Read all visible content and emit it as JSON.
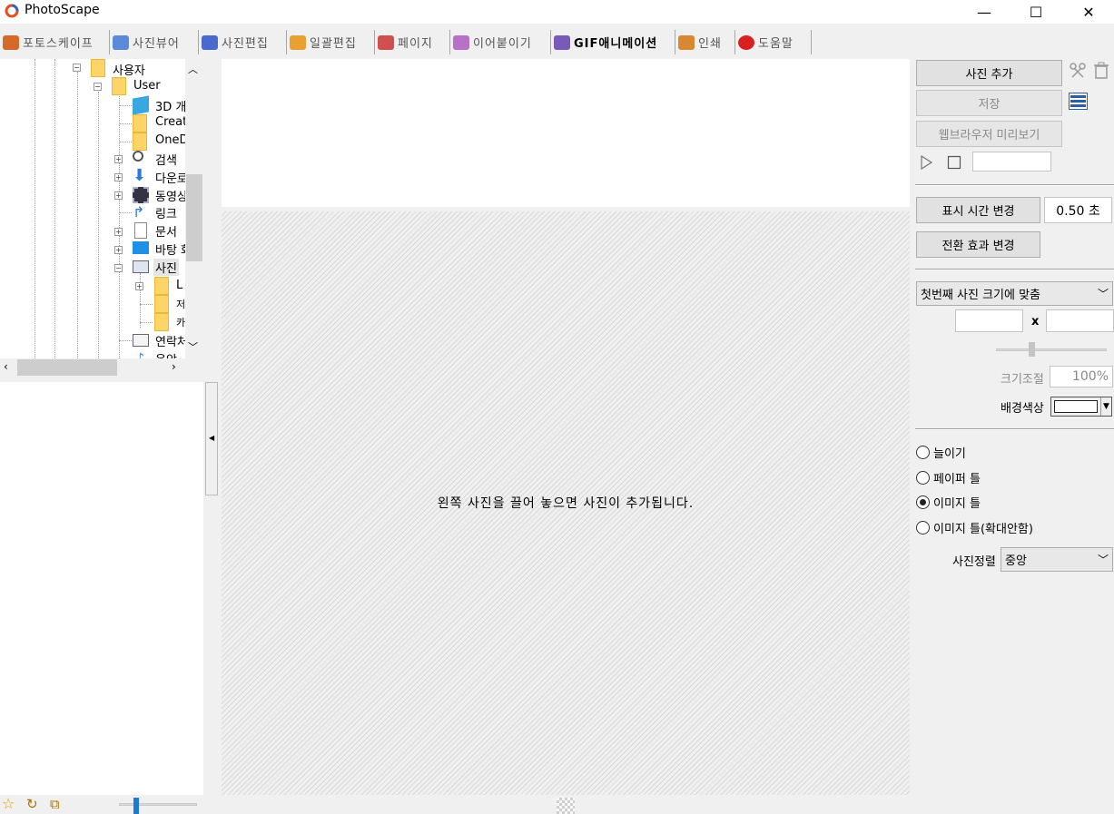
{
  "window": {
    "title": "PhotoScape",
    "minimize": "—",
    "maximize": "☐",
    "close": "✕"
  },
  "tabs": [
    {
      "label": "포토스케이프",
      "color": "#d46a2a",
      "active": false
    },
    {
      "label": "사진뷰어",
      "color": "#5a8ad8",
      "active": false
    },
    {
      "label": "사진편집",
      "color": "#4a6ad0",
      "active": false
    },
    {
      "label": "일괄편집",
      "color": "#e8a030",
      "active": false
    },
    {
      "label": "페이지",
      "color": "#d05050",
      "active": false
    },
    {
      "label": "이어붙이기",
      "color": "#b870c8",
      "active": false
    },
    {
      "label": "GIF애니메이션",
      "color": "#7a5ab8",
      "active": true
    },
    {
      "label": "인쇄",
      "color": "#d88830",
      "active": false
    },
    {
      "label": "도움말",
      "color": "#d82020",
      "active": false
    }
  ],
  "tree": {
    "nodes": [
      {
        "label": "사용자",
        "icon": "folder-icon"
      },
      {
        "label": "User",
        "icon": "folder-icon"
      },
      {
        "label": "3D 개",
        "icon": "cube-icon"
      },
      {
        "label": "Creat",
        "icon": "folder-icon"
      },
      {
        "label": "OneD",
        "icon": "folder-icon"
      },
      {
        "label": "검색",
        "icon": "search-icon"
      },
      {
        "label": "다운로",
        "icon": "download-icon"
      },
      {
        "label": "동영상",
        "icon": "film-icon"
      },
      {
        "label": "링크",
        "icon": "link-icon"
      },
      {
        "label": "문서",
        "icon": "document-icon"
      },
      {
        "label": "바탕 화",
        "icon": "desktop-icon"
      },
      {
        "label": "사진",
        "icon": "pictures-icon"
      },
      {
        "label": "L",
        "icon": "folder-icon"
      },
      {
        "label": "저",
        "icon": "folder-icon"
      },
      {
        "label": "카",
        "icon": "folder-icon"
      },
      {
        "label": "연락처",
        "icon": "contact-icon"
      },
      {
        "label": "음악",
        "icon": "music-icon"
      }
    ]
  },
  "canvas": {
    "message": "왼쪽 사진을 끌어 놓으면 사진이 추가됩니다."
  },
  "right": {
    "add_photo": "사진 추가",
    "save": "저장",
    "web_preview": "웹브라우저 미리보기",
    "display_time_button": "표시 시간 변경",
    "display_time_value": "0.50 초",
    "transition_button": "전환 효과 변경",
    "size_select": "첫번째 사진 크기에 맞춤",
    "size_x": "x",
    "resize_label": "크기조절",
    "resize_value": "100%",
    "bg_color_label": "배경색상",
    "bg_color": "#ffffff",
    "radios": [
      {
        "label": "늘이기",
        "checked": false
      },
      {
        "label": "페이퍼 틀",
        "checked": false
      },
      {
        "label": "이미지 틀",
        "checked": true
      },
      {
        "label": "이미지 틀(확대안함)",
        "checked": false
      }
    ],
    "align_label": "사진정렬",
    "align_select": "중앙"
  }
}
